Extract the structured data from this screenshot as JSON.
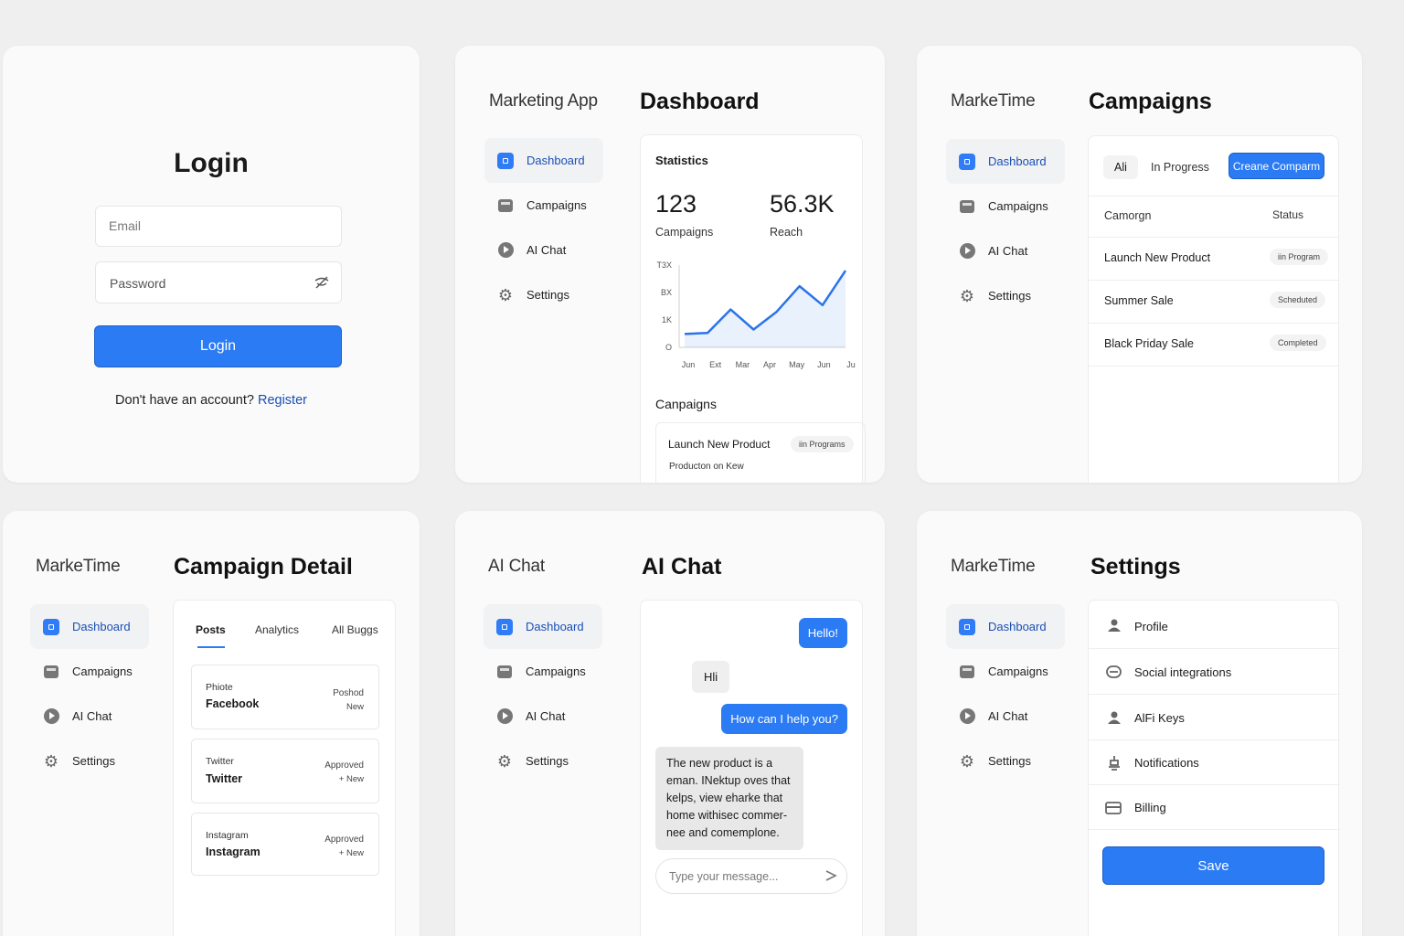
{
  "login": {
    "title": "Login",
    "email_placeholder": "Email",
    "password_placeholder": "Password",
    "button": "Login",
    "register_prompt": "Don't have an account?",
    "register_link": "Register"
  },
  "dashboard": {
    "brand": "Marketing App",
    "title": "Dashboard",
    "nav": [
      "Dashboard",
      "Campaigns",
      "AI Chat",
      "Settings"
    ],
    "stats_title": "Statistics",
    "stat1_value": "123",
    "stat1_label": "Campaigns",
    "stat2_value": "56.3K",
    "stat2_label": "Reach",
    "campaigns_heading": "Canpaigns",
    "campaign_name": "Launch New Product",
    "campaign_badge": "iin Programs",
    "campaign_sub": "Producton on Kew"
  },
  "chart_data": {
    "type": "area",
    "yticks": [
      "T3X",
      "BX",
      "1K",
      "O"
    ],
    "categories": [
      "Jun",
      "Ext",
      "Mar",
      "Apr",
      "May",
      "Jun",
      "Ju"
    ],
    "values": [
      0.6,
      0.65,
      1.7,
      0.8,
      1.6,
      2.75,
      1.9,
      3.45
    ],
    "ylim": [
      0,
      3.7
    ],
    "color": "#2a74e8"
  },
  "campaigns": {
    "brand": "MarkeTime",
    "title": "Campaigns",
    "nav": [
      "Dashboard",
      "Campaigns",
      "AI Chat",
      "Settings"
    ],
    "tabs": [
      "Ali",
      "In Progress"
    ],
    "create_button": "Creane Comparm",
    "col_campaign": "Camorgn",
    "col_status": "Status",
    "rows": [
      {
        "name": "Launch New Product",
        "status": "iin Program"
      },
      {
        "name": "Summer Sale",
        "status": "Scheduted"
      },
      {
        "name": "Black Priday Sale",
        "status": "Completed"
      }
    ]
  },
  "detail": {
    "brand": "MarkeTime",
    "title": "Campaign Detail",
    "nav": [
      "Dashboard",
      "Campaigns",
      "AI Chat",
      "Settings"
    ],
    "tabs": [
      "Posts",
      "Analytics",
      "All Buggs"
    ],
    "posts": [
      {
        "label": "Phiote",
        "name": "Facebook",
        "status": "Poshod",
        "sub": "New"
      },
      {
        "label": "Twitter",
        "name": "Twitter",
        "status": "Approved",
        "sub": "+ New"
      },
      {
        "label": "Instagram",
        "name": "Instagram",
        "status": "Approved",
        "sub": "+ New"
      }
    ]
  },
  "chat": {
    "brand": "AI Chat",
    "title": "AI Chat",
    "nav": [
      "Dashboard",
      "Campaigns",
      "AI Chat",
      "Settings"
    ],
    "msg1": "Hello!",
    "msg2": "Hli",
    "msg3": "How can I help you?",
    "msg4": "The new product is a eman. INektup oves that kelps, view eharke that home withisec commer-nee and comemplone.",
    "input_placeholder": "Type your message...",
    "send_icon": "send-icon"
  },
  "settings": {
    "brand": "MarkeTime",
    "title": "Settings",
    "nav": [
      "Dashboard",
      "Campaigns",
      "AI Chat",
      "Settings"
    ],
    "items": [
      "Profile",
      "Social integrations",
      "AlFi Keys",
      "Notifications",
      "Billing"
    ],
    "save": "Save"
  },
  "colors": {
    "accent": "#2a7bf4",
    "link": "#1a4fb5",
    "background": "#efefef",
    "panel": "#fafafa"
  }
}
